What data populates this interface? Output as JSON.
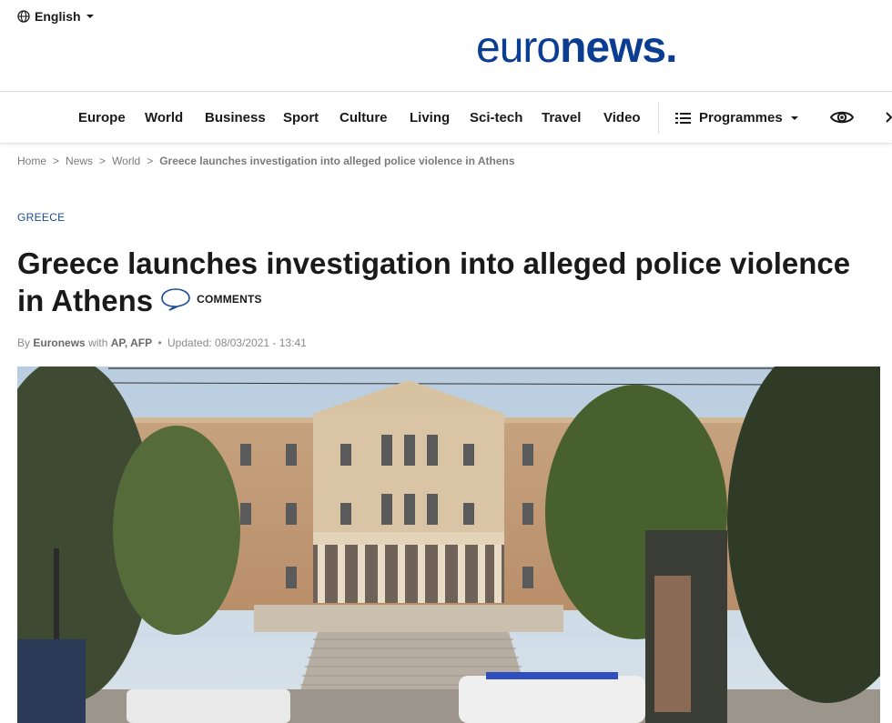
{
  "header": {
    "language_label": "English",
    "logo_light": "euro",
    "logo_bold": "news",
    "logo_dot": "."
  },
  "nav": {
    "items": [
      "Europe",
      "World",
      "Business",
      "Sport",
      "Culture",
      "Living",
      "Sci-tech",
      "Travel",
      "Video"
    ],
    "programmes_label": "Programmes"
  },
  "breadcrumb": {
    "items": [
      "Home",
      "News",
      "World"
    ],
    "separator": ">",
    "current": "Greece launches investigation into alleged police violence in Athens"
  },
  "article": {
    "kicker": "GREECE",
    "headline": "Greece launches investigation into alleged police violence in Athens",
    "comments_label": "COMMENTS",
    "byline": {
      "by": "By",
      "author": "Euronews",
      "with": "with",
      "agencies": "AP, AFP",
      "bullet": "•",
      "updated": "Updated: 08/03/2021 - 13:41"
    }
  },
  "colors": {
    "brand_blue": "#0b3d91",
    "kicker_blue": "#1a4b96",
    "muted_text": "#7a7a7a"
  },
  "icons": {
    "language": "globe-icon",
    "dropdown": "caret-down-icon",
    "programmes": "list-icon",
    "watch": "eye-icon",
    "comments": "speech-bubble-icon"
  }
}
